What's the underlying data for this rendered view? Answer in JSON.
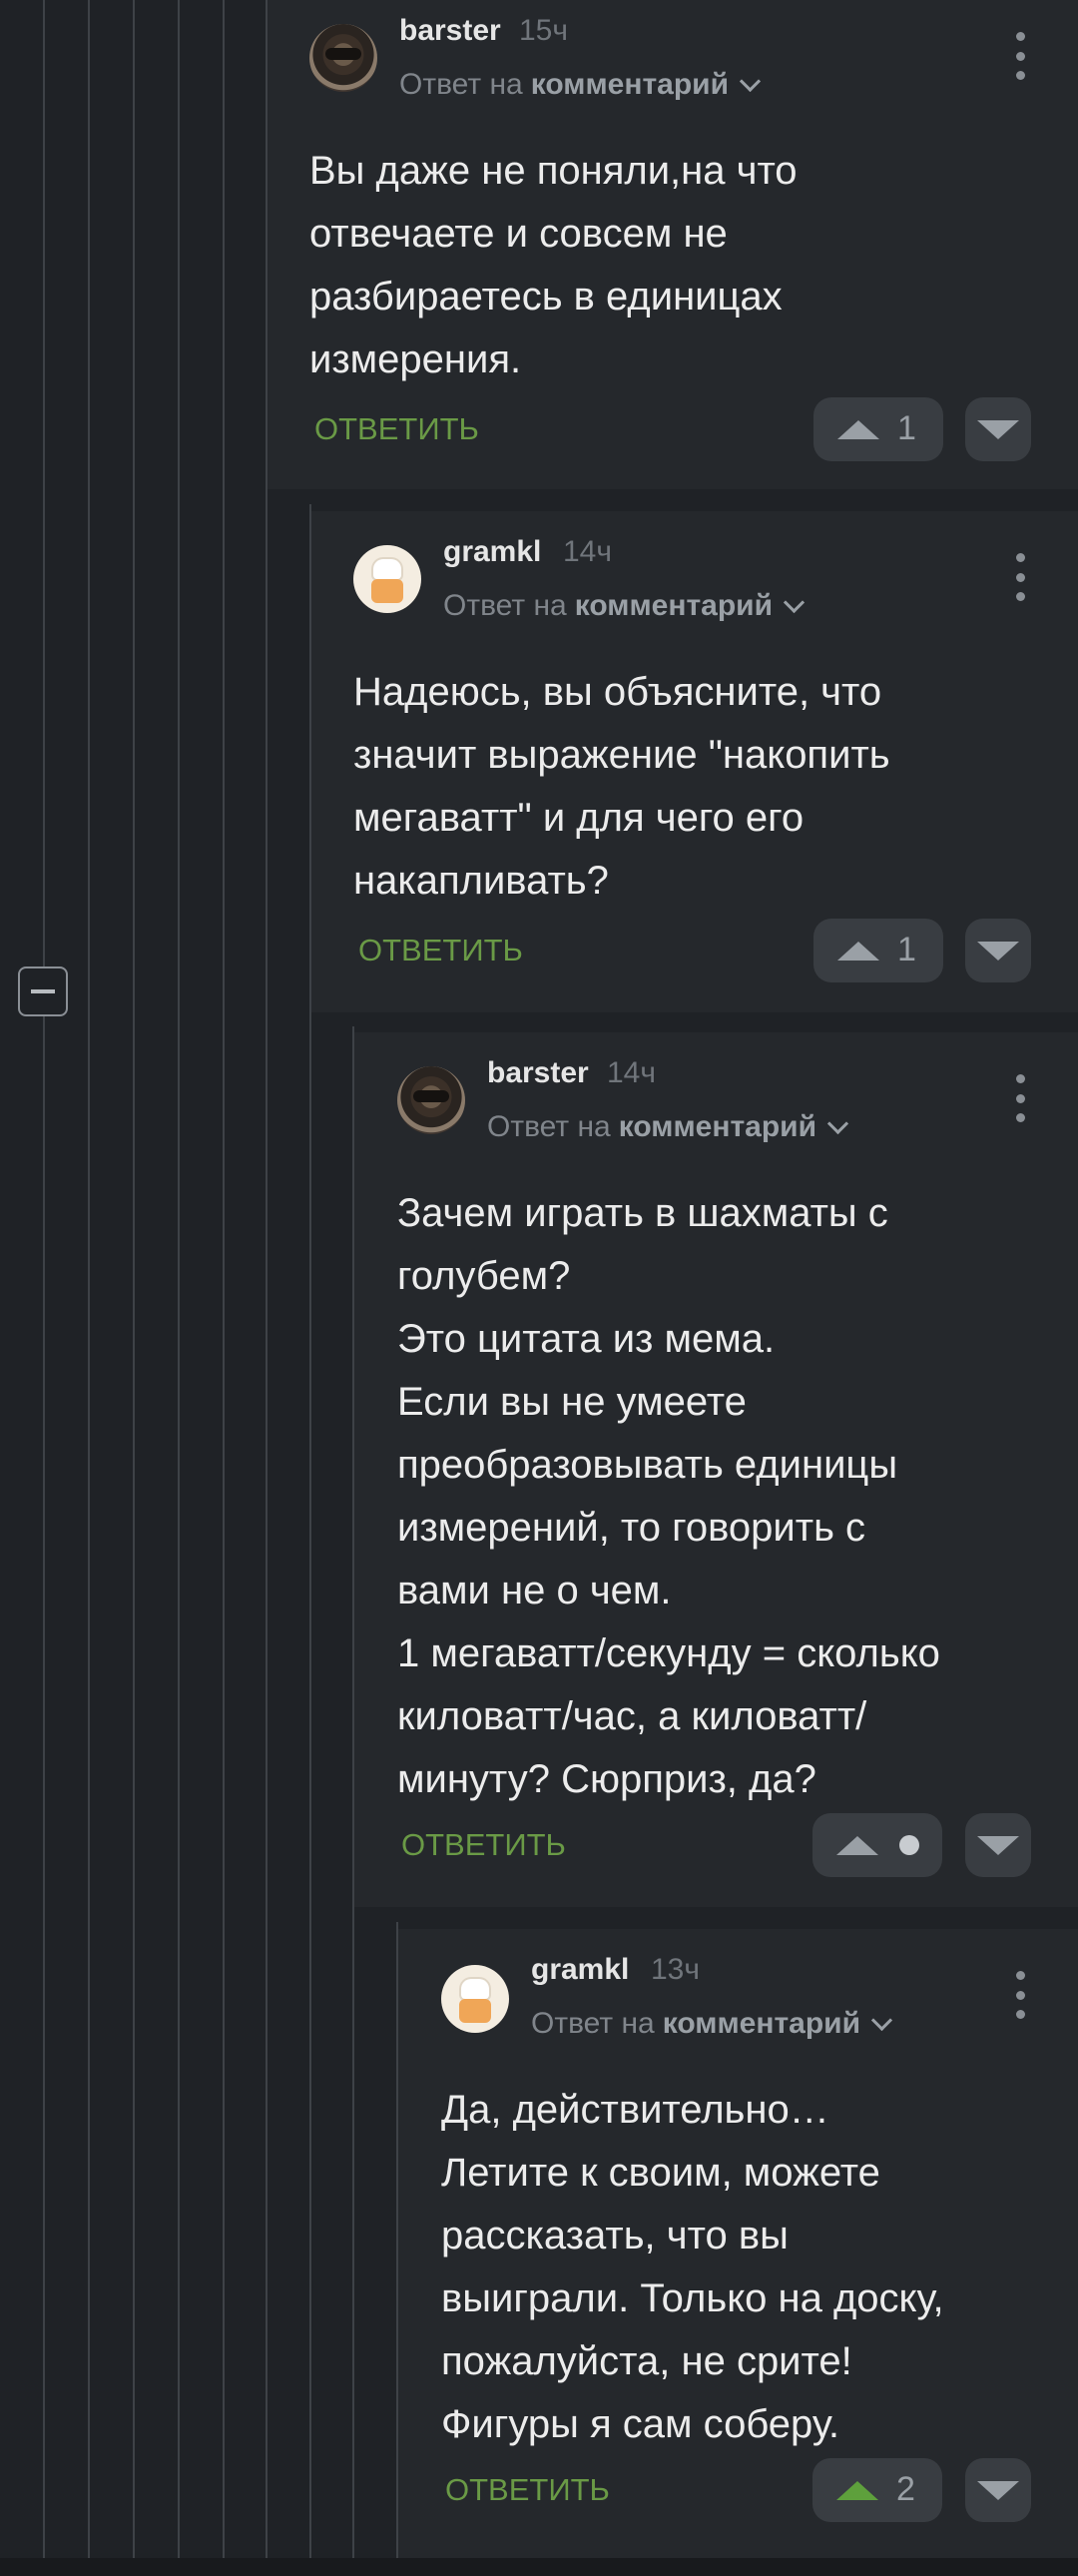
{
  "reply_label": "ОТВЕТИТЬ",
  "reply_to_prefix": "Ответ на",
  "reply_to_target": "комментарий",
  "comments": [
    {
      "author": "barster",
      "time": "15ч",
      "avatar": "raccoon-avatar",
      "text": "Вы даже не поняли,на что\nотвечаете и совсем не\nразбираетесь в единицах\nизмерения.",
      "rating": "1",
      "upvoted": false
    },
    {
      "author": "gramkl",
      "time": "14ч",
      "avatar": "chef-avatar",
      "text": "Надеюсь, вы объясните, что\nзначит выражение \"накопить\nмегаватт\" и для чего его\nнакапливать?",
      "rating": "1",
      "upvoted": false
    },
    {
      "author": "barster",
      "time": "14ч",
      "avatar": "raccoon-avatar",
      "text": "Зачем играть в шахматы с\nголубем?\nЭто цитата из мема.\nЕсли вы не умеете\nпреобразовывать единицы\nизмерений, то говорить с\nвами не о чем.\n1 мегаватт/секунду = сколько\nкиловатт/час, а киловатт/\nминуту? Сюрприз, да?",
      "rating": "",
      "upvoted": false
    },
    {
      "author": "gramkl",
      "time": "13ч",
      "avatar": "chef-avatar",
      "text": "Да, действительно…\nЛетите к своим, можете\nрассказать, что вы\nвыиграли. Только на доску,\nпожалуйста, не срите!\nФигуры я сам соберу.",
      "rating": "2",
      "upvoted": true
    }
  ],
  "icons": {
    "upvote": "triangle-up-icon",
    "downvote": "triangle-down-icon",
    "more": "kebab-menu-icon",
    "collapse": "collapse-minus-icon"
  },
  "colors": {
    "background": "#1f2226",
    "reply_green": "#6a9a46",
    "upvote_active": "#5ea03c"
  }
}
